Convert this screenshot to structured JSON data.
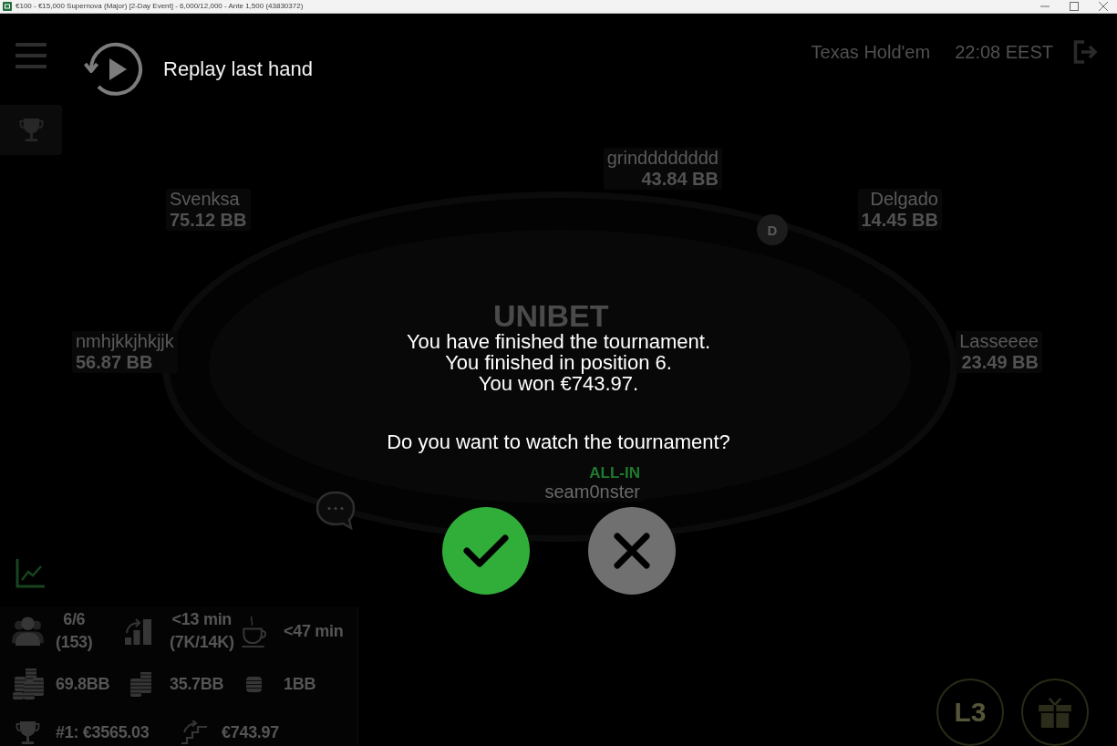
{
  "window": {
    "title": "€100 - €15,000 Supernova (Major) [2-Day Event] - 6,000/12,000 - Ante 1,500 (43830372)",
    "controls": [
      {
        "kind": "minimize"
      },
      {
        "kind": "maximize"
      },
      {
        "kind": "close"
      }
    ]
  },
  "header": {
    "replay": {
      "label": "Replay last hand"
    },
    "game": "Texas Hold'em",
    "clock": "22:08 EEST"
  },
  "table": {
    "logo": "UNIBET",
    "dealer_button": {
      "label": "D"
    },
    "seats": [
      {
        "name": "grindddddddd",
        "stack": "43.84 BB",
        "dealer": false
      },
      {
        "name": "Svenksa",
        "stack": "75.12 BB",
        "dealer": false
      },
      {
        "name": "Delgado",
        "stack": "14.45 BB",
        "dealer": true
      },
      {
        "name": "nmhjkkjhkjjk",
        "stack": "56.87 BB",
        "dealer": false
      },
      {
        "name": "Lasseeee",
        "stack": "23.49 BB",
        "dealer": false
      },
      {
        "name": "seam0nster",
        "status": "ALL-IN",
        "dealer": false
      }
    ]
  },
  "dialog": {
    "message": [
      "You have finished the tournament.",
      "You finished in position 6.",
      "You won €743.97."
    ],
    "question": "Do you want to watch the tournament?",
    "buttons": [
      {
        "kind": "confirm"
      },
      {
        "kind": "cancel"
      }
    ]
  },
  "stats": [
    [
      {
        "kind": "players",
        "lines": [
          "6/6",
          "(153)"
        ]
      },
      {
        "kind": "blinds",
        "lines": [
          "<13 min",
          "(7K/14K)"
        ]
      },
      {
        "kind": "break",
        "lines": [
          "<47 min"
        ]
      }
    ],
    [
      {
        "kind": "chips_many",
        "lines": [
          "69.8BB"
        ]
      },
      {
        "kind": "chips_two",
        "lines": [
          "35.7BB"
        ]
      },
      {
        "kind": "chips_one",
        "lines": [
          "1BB"
        ]
      }
    ],
    [
      {
        "kind": "first_prize",
        "lines": [
          "#1: €3565.03"
        ]
      },
      {
        "kind": "next_payout",
        "lines": [
          "€743.97"
        ]
      }
    ]
  ],
  "corner_buttons": [
    {
      "kind": "level",
      "label": "L3"
    },
    {
      "kind": "gift"
    }
  ]
}
